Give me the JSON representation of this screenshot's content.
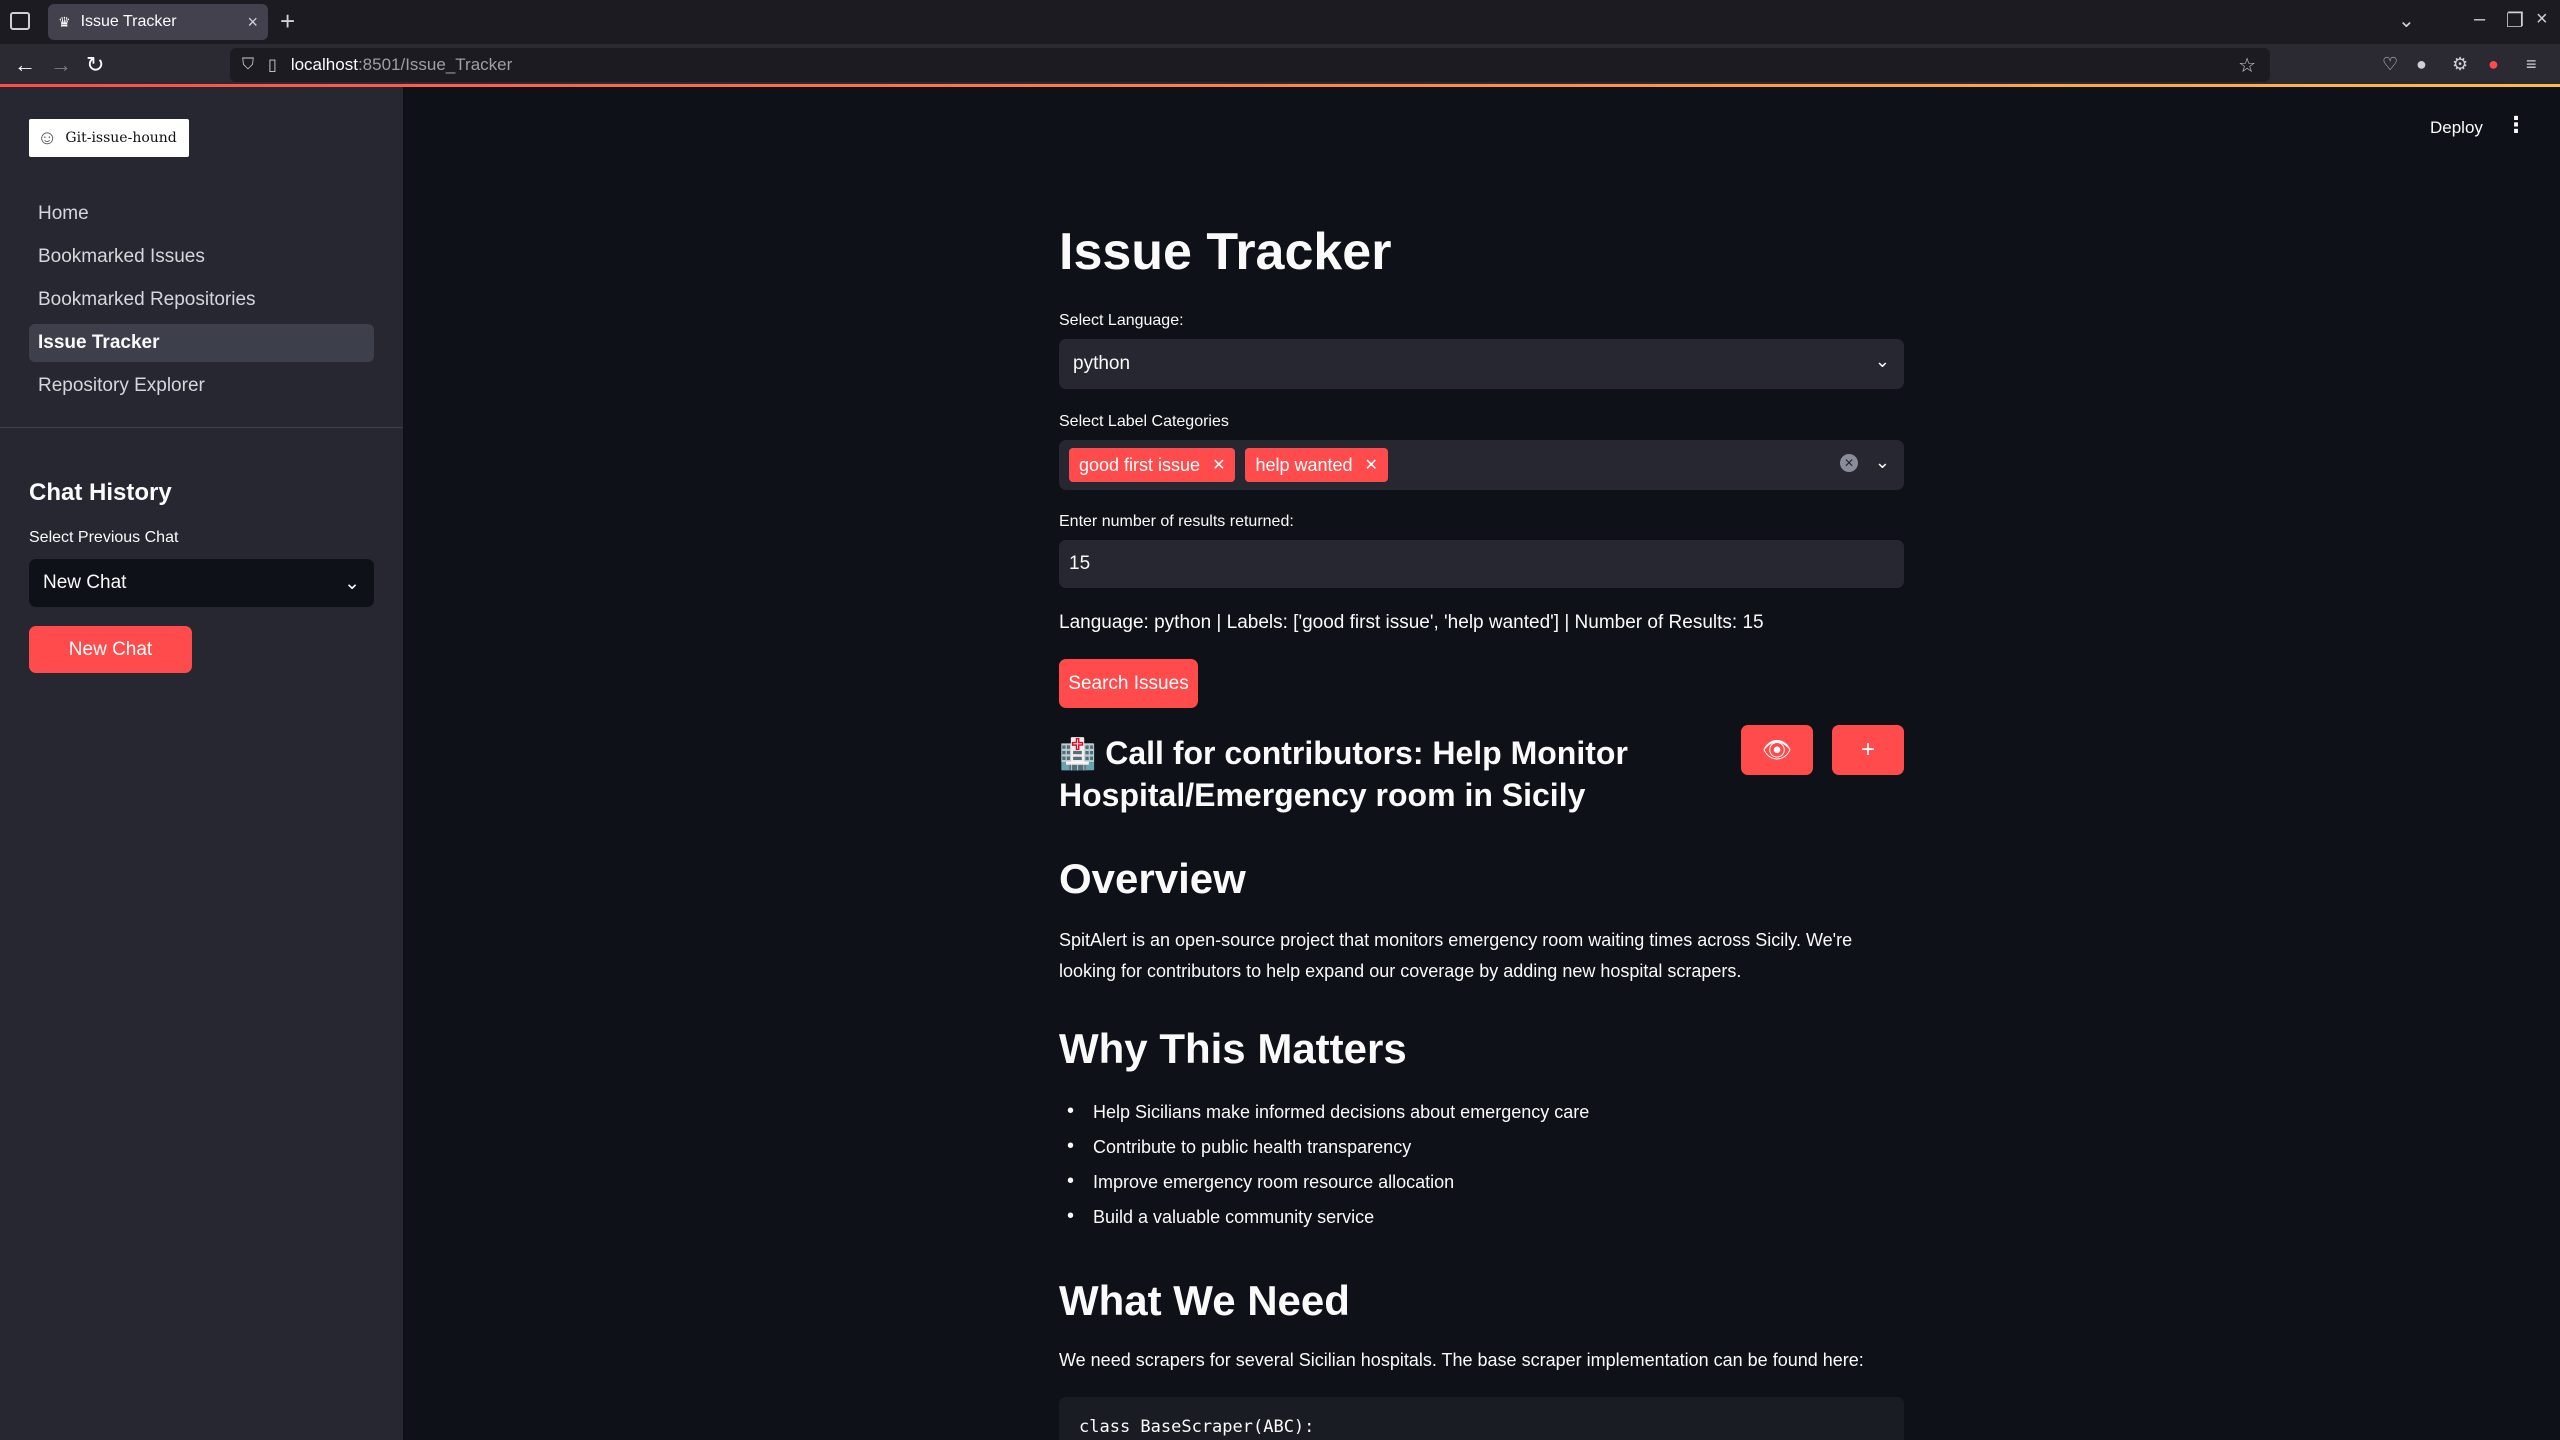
{
  "browser": {
    "tab_title": "Issue Tracker",
    "url_host": "localhost",
    "url_path": ":8501/Issue_Tracker"
  },
  "sidebar": {
    "logo_text": "Git-issue-hound",
    "nav": [
      {
        "label": "Home"
      },
      {
        "label": "Bookmarked Issues"
      },
      {
        "label": "Bookmarked Repositories"
      },
      {
        "label": "Issue Tracker"
      },
      {
        "label": "Repository Explorer"
      }
    ],
    "chat_history_title": "Chat History",
    "previous_chat_label": "Select Previous Chat",
    "previous_chat_value": "New Chat",
    "new_chat_label": "New Chat"
  },
  "header": {
    "deploy_label": "Deploy"
  },
  "main": {
    "title": "Issue Tracker",
    "language_label": "Select Language:",
    "language_value": "python",
    "labels_label": "Select Label Categories",
    "tags": [
      "good first issue",
      "help wanted"
    ],
    "results_label": "Enter number of results returned:",
    "results_value": "15",
    "summary": "Language: python | Labels: ['good first issue', 'help wanted'] | Number of Results: 15",
    "search_label": "Search Issues",
    "issue_icon": "🏥",
    "issue_title": "Call for contributors: Help Monitor Hospital/Emergency room in Sicily",
    "overview_heading": "Overview",
    "overview_text": "SpitAlert is an open-source project that monitors emergency room waiting times across Sicily. We're looking for contributors to help expand our coverage by adding new hospital scrapers.",
    "why_heading": "Why This Matters",
    "why_items": [
      "Help Sicilians make informed decisions about emergency care",
      "Contribute to public health transparency",
      "Improve emergency room resource allocation",
      "Build a valuable community service"
    ],
    "need_heading": "What We Need",
    "need_text": "We need scrapers for several Sicilian hospitals. The base scraper implementation can be found here:",
    "code_line": "class BaseScraper(ABC):"
  }
}
